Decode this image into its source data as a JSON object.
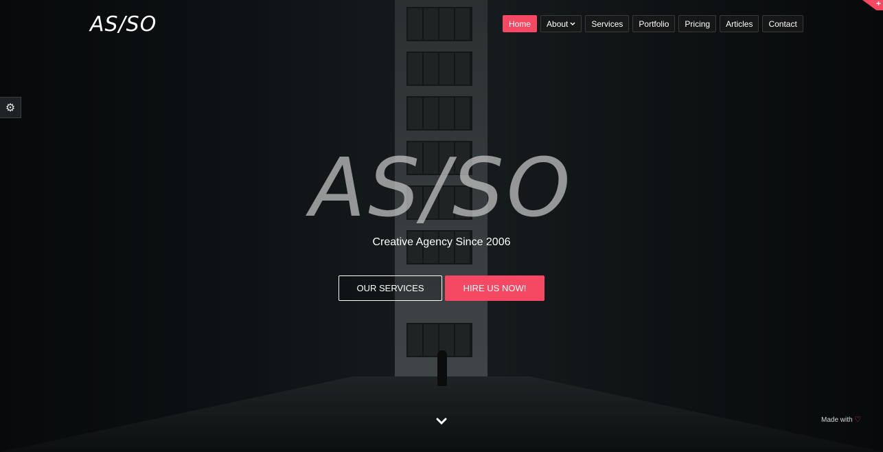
{
  "brand": {
    "logo": "AS/SO"
  },
  "nav": {
    "items": [
      {
        "label": "Home",
        "active": true
      },
      {
        "label": "About",
        "dropdown": true
      },
      {
        "label": "Services"
      },
      {
        "label": "Portfolio"
      },
      {
        "label": "Pricing"
      },
      {
        "label": "Articles"
      },
      {
        "label": "Contact"
      }
    ]
  },
  "corner": {
    "icon": "plus-icon",
    "symbol": "+"
  },
  "settings": {
    "icon": "gear-icon",
    "symbol": "⚙"
  },
  "hero": {
    "title": "AS/SO",
    "subtitle": "Creative Agency Since 2006",
    "primary_button": "OUR SERVICES",
    "secondary_button": "HIRE US NOW!"
  },
  "scroll": {
    "icon": "chevron-down-icon"
  },
  "footer": {
    "made_with": "Made with",
    "heart_icon": "heart-icon",
    "heart_symbol": "♡"
  },
  "colors": {
    "accent": "#f54963",
    "text": "#ffffff"
  }
}
